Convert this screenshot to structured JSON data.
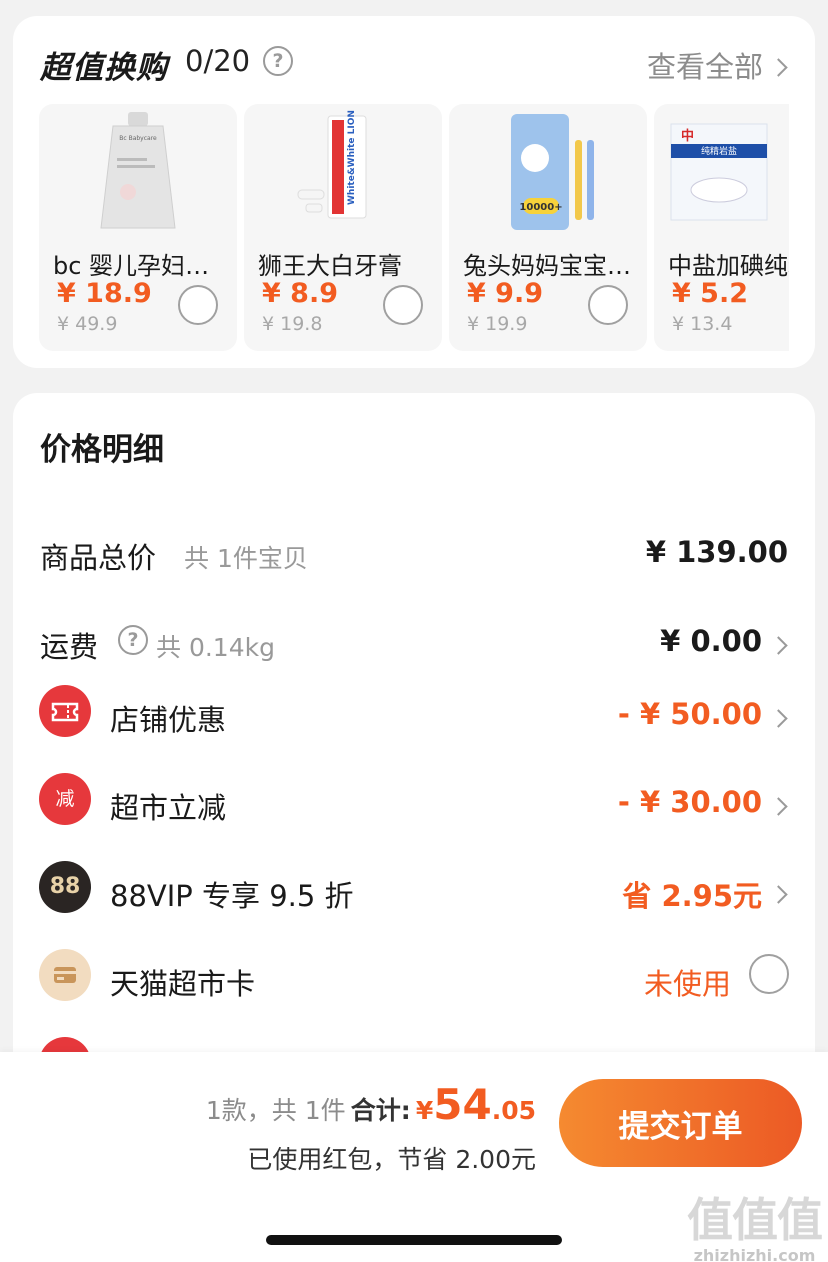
{
  "swap": {
    "title": "超值换购",
    "count": "0/20",
    "view_all": "查看全部",
    "products": [
      {
        "name": "bc 婴儿孕妇洗衣液",
        "price": "¥ 18.9",
        "orig": "¥ 49.9",
        "img_text": "Bc Babycare"
      },
      {
        "name": "狮王大白牙膏",
        "price": "¥ 8.9",
        "orig": "¥ 19.8",
        "img_text": "White&White LION"
      },
      {
        "name": "兔头妈妈宝宝牙刷",
        "price": "¥ 9.9",
        "orig": "¥ 19.9",
        "img_text": "10000+"
      },
      {
        "name": "中盐加碘纯精岩盐",
        "price": "¥ 5.2",
        "orig": "¥ 13.4",
        "img_text": "纯精岩盐"
      }
    ]
  },
  "price_detail": {
    "title": "价格明细",
    "goods_total_label": "商品总价",
    "goods_total_sub": "共 1件宝贝",
    "goods_total_value": "¥ 139.00",
    "shipping_label": "运费",
    "shipping_sub": "共 0.14kg",
    "shipping_value": "¥ 0.00",
    "shop_discount_label": "店铺优惠",
    "shop_discount_value": "- ¥ 50.00",
    "market_cut_label": "超市立减",
    "market_cut_icon_text": "减",
    "market_cut_value": "- ¥ 30.00",
    "vip_label": "88VIP 专享 9.5 折",
    "vip_icon_text": "88",
    "vip_value": "省 2.95元",
    "card_label": "天猫超市卡",
    "card_value": "未使用"
  },
  "bottom_bar": {
    "count": "1款，共 1件",
    "total_label": "合计:",
    "yen": "¥",
    "total_int": "54",
    "total_dec": ".05",
    "saved": "已使用红包，节省 2.00元",
    "submit": "提交订单"
  },
  "watermark": {
    "logo": "值值值",
    "url": "zhizhizhi.com"
  },
  "colors": {
    "accent": "#f25c21",
    "button": "#ec5a25",
    "red_icon": "#e6383c"
  }
}
